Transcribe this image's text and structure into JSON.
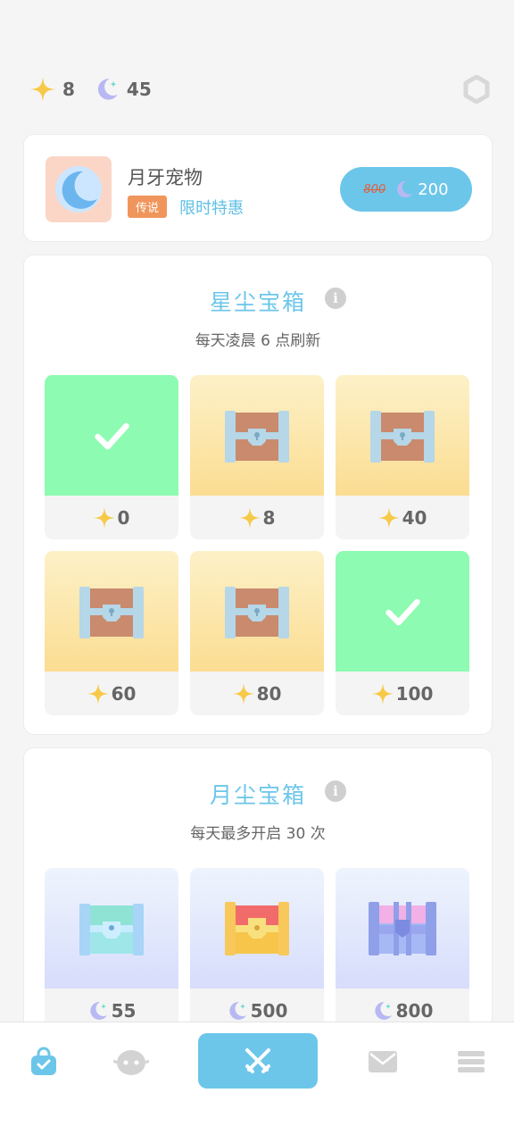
{
  "currencies": {
    "stardust": {
      "icon": "star-icon",
      "value": "8"
    },
    "moondust": {
      "icon": "moon-icon",
      "value": "45"
    }
  },
  "pet_offer": {
    "name": "月牙宠物",
    "badge": "传说",
    "deal": "限时特惠",
    "old_price": "800",
    "new_price": "200"
  },
  "stardust_box": {
    "title": "星尘宝箱",
    "subtitle": "每天凌晨 6 点刷新",
    "items": [
      {
        "state": "opened",
        "price": "0"
      },
      {
        "state": "chest",
        "price": "8"
      },
      {
        "state": "chest",
        "price": "40"
      },
      {
        "state": "chest",
        "price": "60"
      },
      {
        "state": "chest",
        "price": "80"
      },
      {
        "state": "opened",
        "price": "100"
      }
    ]
  },
  "moondust_box": {
    "title": "月尘宝箱",
    "subtitle": "每天最多开启 30 次",
    "items": [
      {
        "state": "teal-chest",
        "price": "55"
      },
      {
        "state": "red-chest",
        "price": "500"
      },
      {
        "state": "purple-chest",
        "price": "800"
      }
    ]
  },
  "colors": {
    "accent": "#6cc6ea",
    "opened": "#8dfbb1",
    "badge": "#f0955b"
  },
  "bottom_nav": [
    "shop-bag-icon",
    "pet-face-icon",
    "battle-swords-icon",
    "mail-icon",
    "menu-icon"
  ]
}
